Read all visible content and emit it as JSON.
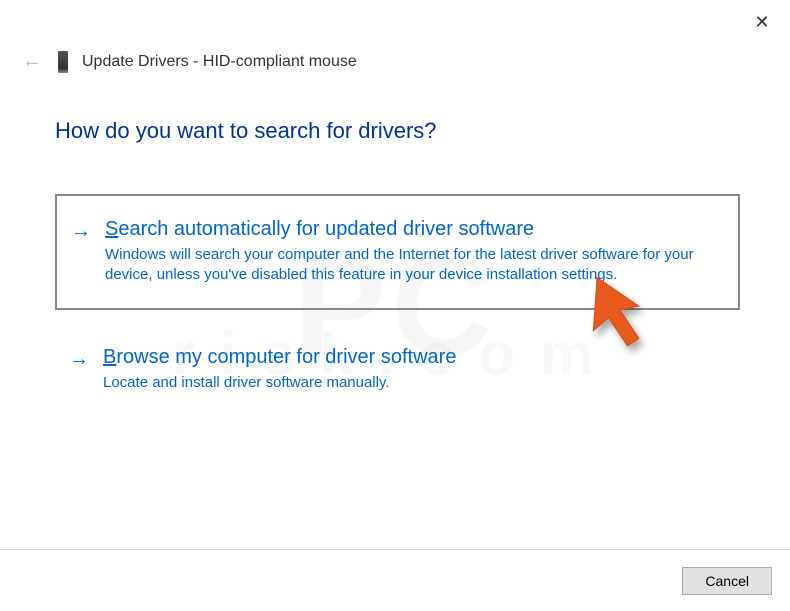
{
  "header": {
    "title": "Update Drivers - HID-compliant mouse"
  },
  "heading": "How do you want to search for drivers?",
  "options": {
    "auto": {
      "access_key": "S",
      "title_rest": "earch automatically for updated driver software",
      "description": "Windows will search your computer and the Internet for the latest driver software for your device, unless you've disabled this feature in your device installation settings."
    },
    "browse": {
      "access_key": "B",
      "title_rest": "rowse my computer for driver software",
      "description": "Locate and install driver software manually."
    }
  },
  "footer": {
    "cancel": "Cancel"
  },
  "watermark": {
    "main": "PC",
    "sub": "risk.com"
  }
}
